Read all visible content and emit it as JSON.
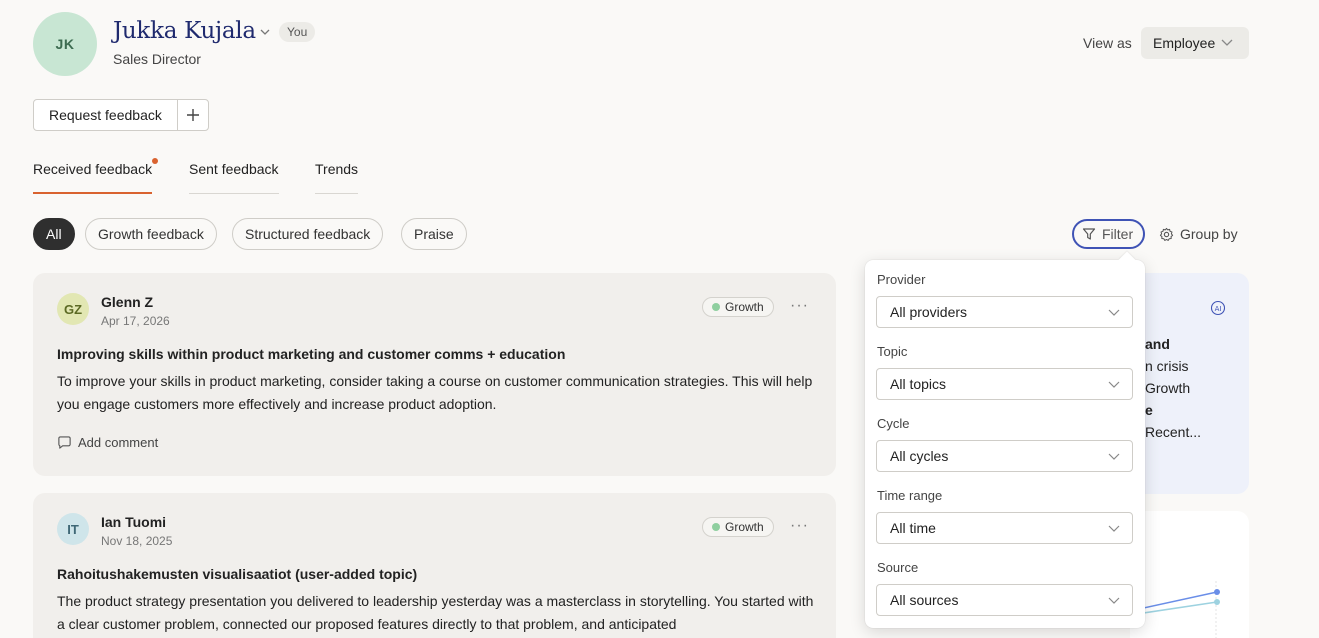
{
  "profile": {
    "initials": "JK",
    "name": "Jukka Kujala",
    "you_badge": "You",
    "role": "Sales Director"
  },
  "view_as": {
    "label": "View as",
    "value": "Employee"
  },
  "actions": {
    "request_feedback": "Request feedback",
    "add": "+"
  },
  "tabs": [
    {
      "label": "Received feedback",
      "active": true,
      "has_dot": true
    },
    {
      "label": "Sent feedback",
      "active": false
    },
    {
      "label": "Trends",
      "active": false
    }
  ],
  "chips": [
    {
      "label": "All",
      "active": true
    },
    {
      "label": "Growth feedback",
      "active": false
    },
    {
      "label": "Structured feedback",
      "active": false
    },
    {
      "label": "Praise",
      "active": false
    }
  ],
  "toolbar": {
    "filter": "Filter",
    "group_by": "Group by"
  },
  "feedback": [
    {
      "initials": "GZ",
      "author": "Glenn Z",
      "date": "Apr 17, 2026",
      "tag": "Growth",
      "more": "···",
      "title": "Improving skills within product marketing and customer comms + education",
      "body": "To improve your skills in product marketing, consider taking a course on customer communication strategies. This will help you engage customers more effectively and increase product adoption.",
      "comment": "Add comment"
    },
    {
      "initials": "IT",
      "author": "Ian Tuomi",
      "date": "Nov 18, 2025",
      "tag": "Growth",
      "more": "···",
      "title": "Rahoitushakemusten visualisaatiot (user-added topic)",
      "body": "The product strategy presentation you delivered to leadership yesterday was a masterclass in storytelling. You started with a clear customer problem, connected our proposed features directly to that problem, and anticipated"
    }
  ],
  "side_panel": {
    "lines": [
      "and",
      "n crisis",
      "Growth",
      "e",
      "Recent..."
    ]
  },
  "filter_popover": {
    "fields": [
      {
        "label": "Provider",
        "value": "All providers"
      },
      {
        "label": "Topic",
        "value": "All topics"
      },
      {
        "label": "Cycle",
        "value": "All cycles"
      },
      {
        "label": "Time range",
        "value": "All time"
      },
      {
        "label": "Source",
        "value": "All sources"
      }
    ]
  },
  "colors": {
    "accent": "#d9622f",
    "filter_border": "#3f53b5",
    "name": "#1f2a6e",
    "growth_dot": "#8fcf9f"
  }
}
